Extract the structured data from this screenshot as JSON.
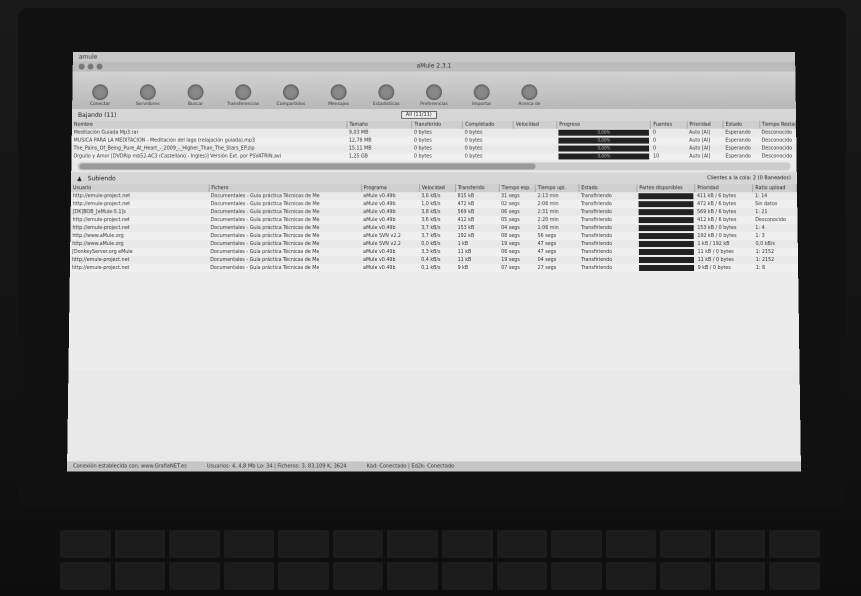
{
  "window": {
    "title": "aMule 2.3.1",
    "app_menu": "amule"
  },
  "toolbar": [
    {
      "label": "Conectar",
      "icon": "connect-icon"
    },
    {
      "label": "Servidores",
      "icon": "servers-icon"
    },
    {
      "label": "Buscar",
      "icon": "search-icon"
    },
    {
      "label": "Transferencias",
      "icon": "transfers-icon"
    },
    {
      "label": "Compartidos",
      "icon": "shared-icon"
    },
    {
      "label": "Mensajes",
      "icon": "messages-icon"
    },
    {
      "label": "Estadísticas",
      "icon": "stats-icon"
    },
    {
      "label": "Preferencias",
      "icon": "prefs-icon"
    },
    {
      "label": "Importar",
      "icon": "import-icon"
    },
    {
      "label": "Acerca de",
      "icon": "about-icon"
    }
  ],
  "downloads": {
    "header": "Bajando (11)",
    "tab_button": "All (11/11)",
    "columns": [
      "Nombre",
      "Tamaño",
      "Transferido",
      "Completado",
      "Velocidad",
      "Progreso",
      "Fuentes",
      "Prioridad",
      "Estado",
      "Tiempo Restante"
    ],
    "rows": [
      {
        "name": "Meditación Guiada Mp3.rar",
        "size": "9,03 MB",
        "transferred": "0 bytes",
        "completed": "0 bytes",
        "speed": "",
        "progress": "0,00%",
        "sources": "0",
        "priority": "Auto [Al]",
        "status": "Esperando",
        "remaining": "Desconocido"
      },
      {
        "name": "MUSICA PARA LA MEDITACION - Meditación del lago (relajación guiada).mp3",
        "size": "12,78 MB",
        "transferred": "0 bytes",
        "completed": "0 bytes",
        "speed": "",
        "progress": "0,00%",
        "sources": "0",
        "priority": "Auto [Al]",
        "status": "Esperando",
        "remaining": "Desconocido"
      },
      {
        "name": "The_Pains_Of_Being_Pure_At_Heart_-_2009_-_Higher_Than_The_Stars_EP.zip",
        "size": "15,11 MB",
        "transferred": "0 bytes",
        "completed": "0 bytes",
        "speed": "",
        "progress": "0,00%",
        "sources": "0",
        "priority": "Auto [Al]",
        "status": "Esperando",
        "remaining": "Desconocido"
      },
      {
        "name": "Orgullo y Amor [DVDRip mb52-AC3 (Castellano - Ingles)] Versión Ext. por PSVATRIN.avi",
        "size": "1,25 GB",
        "transferred": "0 bytes",
        "completed": "0 bytes",
        "speed": "",
        "progress": "0,00%",
        "sources": "10",
        "priority": "Auto [Al]",
        "status": "Esperando",
        "remaining": "Desconocido"
      }
    ]
  },
  "uploads": {
    "header": "Subiendo",
    "right_text": "Clientes a la cola: 2 (0 Baneados)",
    "columns": [
      "Usuario",
      "Fichero",
      "Programa",
      "Velocidad",
      "Transferido",
      "Tiempo esp.",
      "Tiempo upl.",
      "Estado",
      "Partes disponibles",
      "Prioridad",
      "Ratio upload"
    ],
    "rows": [
      {
        "user": "http://emule-project.net",
        "file": "Documentales - Guía práctica Técnicas de Me",
        "client": "aMule v0.49b",
        "speed": "3,6 kB/s",
        "transferred": "815 kB",
        "wait": "31 segs",
        "upload": "2:13 min",
        "status": "Transfiriendo",
        "prio": "411 kB / 6 bytes",
        "ratio": "1: 14"
      },
      {
        "user": "http://emule-project.net",
        "file": "Documentales - Guía práctica Técnicas de Me",
        "client": "aMule v0.49b",
        "speed": "1,0 kB/s",
        "transferred": "472 kB",
        "wait": "02 segs",
        "upload": "2:08 min",
        "status": "Transfiriendo",
        "prio": "472 kB / 6 bytes",
        "ratio": "Sin datos"
      },
      {
        "user": "[DK]BOB_[eMule-5.1]s",
        "file": "Documentales - Guía práctica Técnicas de Me",
        "client": "aMule v0.49b",
        "speed": "3,8 kB/s",
        "transferred": "569 kB",
        "wait": "06 segs",
        "upload": "2:31 min",
        "status": "Transfiriendo",
        "prio": "569 kB / 6 bytes",
        "ratio": "1: 21"
      },
      {
        "user": "http://emule-project.net",
        "file": "Documentales - Guía práctica Técnicas de Me",
        "client": "aMule v0.49b",
        "speed": "3,6 kB/s",
        "transferred": "412 kB",
        "wait": "05 segs",
        "upload": "2:20 min",
        "status": "Transfiriendo",
        "prio": "412 kB / 6 bytes",
        "ratio": "Desconocido"
      },
      {
        "user": "http://emule-project.net",
        "file": "Documentales - Guía práctica Técnicas de Me",
        "client": "aMule v0.49b",
        "speed": "3,7 kB/s",
        "transferred": "153 kB",
        "wait": "04 segs",
        "upload": "1:06 min",
        "status": "Transfiriendo",
        "prio": "153 kB / 0 bytes",
        "ratio": "1: 4"
      },
      {
        "user": "http://www.aMule.org",
        "file": "Documentales - Guía práctica Técnicas de Me",
        "client": "aMule SVN v2.2",
        "speed": "3,7 kB/s",
        "transferred": "192 kB",
        "wait": "08 segs",
        "upload": "56 segs",
        "status": "Transfiriendo",
        "prio": "192 kB / 0 bytes",
        "ratio": "1: 3"
      },
      {
        "user": "http://www.aMule.org",
        "file": "Documentales - Guía práctica Técnicas de Me",
        "client": "aMule SVN v2.2",
        "speed": "0,0 kB/s",
        "transferred": "1 kB",
        "wait": "19 segs",
        "upload": "47 segs",
        "status": "Transfiriendo",
        "prio": "1 kB / 192 kB",
        "ratio": "0,0 kB/s"
      },
      {
        "user": "[DonkeyServer.org eMule",
        "file": "Documentales - Guía práctica Técnicas de Me",
        "client": "aMule v0.49b",
        "speed": "3,3 kB/s",
        "transferred": "11 kB",
        "wait": "06 segs",
        "upload": "47 segs",
        "status": "Transfiriendo",
        "prio": "11 kB / 0 bytes",
        "ratio": "1: 2152"
      },
      {
        "user": "http://emule-project.net",
        "file": "Documentales - Guía práctica Técnicas de Me",
        "client": "aMule v0.49b",
        "speed": "0,4 kB/s",
        "transferred": "11 kB",
        "wait": "19 segs",
        "upload": "04 segs",
        "status": "Transfiriendo",
        "prio": "11 kB / 0 bytes",
        "ratio": "1: 2152"
      },
      {
        "user": "http://emule-project.net",
        "file": "Documentales - Guía práctica Técnicas de Me",
        "client": "aMule v0.49b",
        "speed": "0,1 kB/s",
        "transferred": "9 kB",
        "wait": "07 segs",
        "upload": "27 segs",
        "status": "Transfiriendo",
        "prio": "9 kB / 0 bytes",
        "ratio": "1: 8"
      }
    ]
  },
  "status": {
    "left": "Conexión establecida con: www.GrafiaNET.es",
    "middle": "Usuarios: 4, 4,8 Mb Lo: 34 | Ficheros: 3, 83,109 K, 3624",
    "right": "Kad: Conectado | Ed2k: Conectado"
  }
}
